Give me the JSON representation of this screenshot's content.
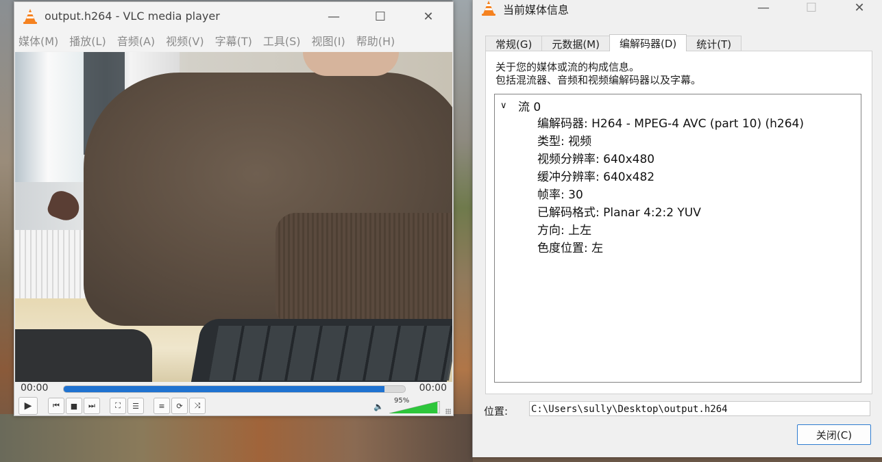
{
  "vlc": {
    "title": "output.h264 - VLC media player",
    "menu": [
      "媒体(M)",
      "播放(L)",
      "音频(A)",
      "视频(V)",
      "字幕(T)",
      "工具(S)",
      "视图(I)",
      "帮助(H)"
    ],
    "time_elapsed": "00:00",
    "time_total": "00:00",
    "seek_progress": 0.94,
    "volume": "95%",
    "volume_level": 0.95,
    "colors": {
      "seek": "#1f72d0",
      "volume": "#2dc63b",
      "cone": "#f58220"
    }
  },
  "info": {
    "title": "当前媒体信息",
    "tabs": [
      "常规(G)",
      "元数据(M)",
      "编解码器(D)",
      "统计(T)"
    ],
    "active_tab": 2,
    "desc_line1": "关于您的媒体或流的构成信息。",
    "desc_line2": "包括混流器、音频和视频编解码器以及字幕。",
    "stream_label": "流 0",
    "details": [
      "编解码器: H264 - MPEG-4 AVC (part 10) (h264)",
      "类型: 视频",
      "视频分辨率: 640x480",
      "缓冲分辨率: 640x482",
      "帧率: 30",
      "已解码格式: Planar 4:2:2 YUV",
      "方向: 上左",
      "色度位置: 左"
    ],
    "location_label": "位置:",
    "location_value": "C:\\Users\\sully\\Desktop\\output.h264",
    "close_label": "关闭(C)"
  }
}
